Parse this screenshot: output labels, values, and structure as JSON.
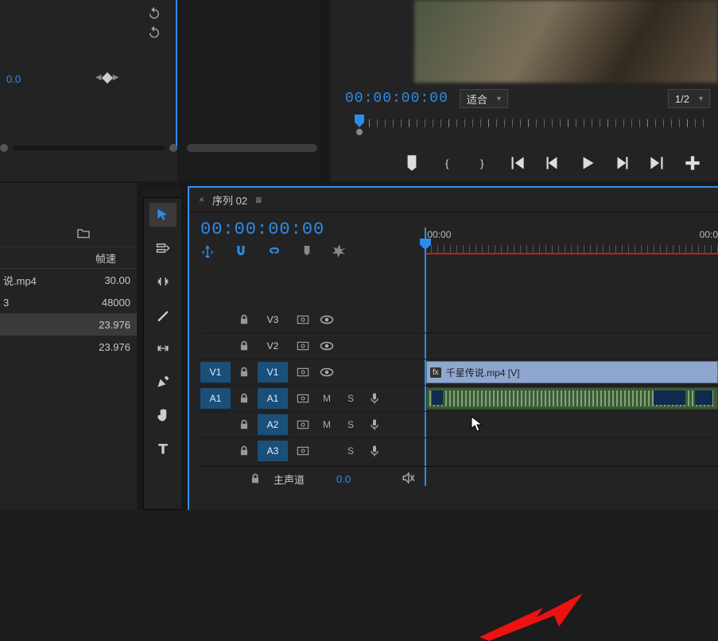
{
  "effect_controls": {
    "value": "0.0",
    "reset_icon": "reset",
    "prev_kf_icon": "◀",
    "kf_icon": "◆",
    "next_kf_icon": "▶"
  },
  "program": {
    "timecode": "00:00:00:00",
    "fit_label": "适合",
    "resolution_label": "1/2",
    "transport": {
      "marker": "▮",
      "in_bracket": "{",
      "out_bracket": "}",
      "go_in": "|◀",
      "step_back": "◀|",
      "play": "▶",
      "step_fwd": "|▶",
      "go_out": "▶|",
      "lift": "⯐"
    }
  },
  "project": {
    "header_name": "",
    "header_fps": "帧速",
    "rows": [
      {
        "name": "说.mp4",
        "fps": "30.00",
        "selected": false
      },
      {
        "name": "3",
        "fps": "48000",
        "selected": false
      },
      {
        "name": "",
        "fps": "23.976",
        "selected": true
      },
      {
        "name": "",
        "fps": "23.976",
        "selected": false
      }
    ]
  },
  "tools": {
    "selection": "selection-tool",
    "track_select": "track-select-tool",
    "ripple": "ripple-edit-tool",
    "razor": "razor-tool",
    "slip": "slip-tool",
    "pen": "pen-tool",
    "hand": "hand-tool",
    "type": "type-tool"
  },
  "timeline": {
    "close": "×",
    "tab_label": "序列 02",
    "menu": "≡",
    "timecode": "00:00:00:00",
    "ruler": {
      "left_label": ":00:00",
      "right_label": "00:0"
    },
    "tracks": {
      "v3": "V3",
      "v2": "V2",
      "v1_src": "V1",
      "v1": "V1",
      "a1_src": "A1",
      "a1": "A1",
      "a2": "A2",
      "a3": "A3",
      "mute": "M",
      "solo": "S"
    },
    "clip_v1": {
      "fx": "fx",
      "name": "千星传说.mp4 [V]"
    },
    "master": {
      "label": "主声道",
      "value": "0.0"
    }
  }
}
